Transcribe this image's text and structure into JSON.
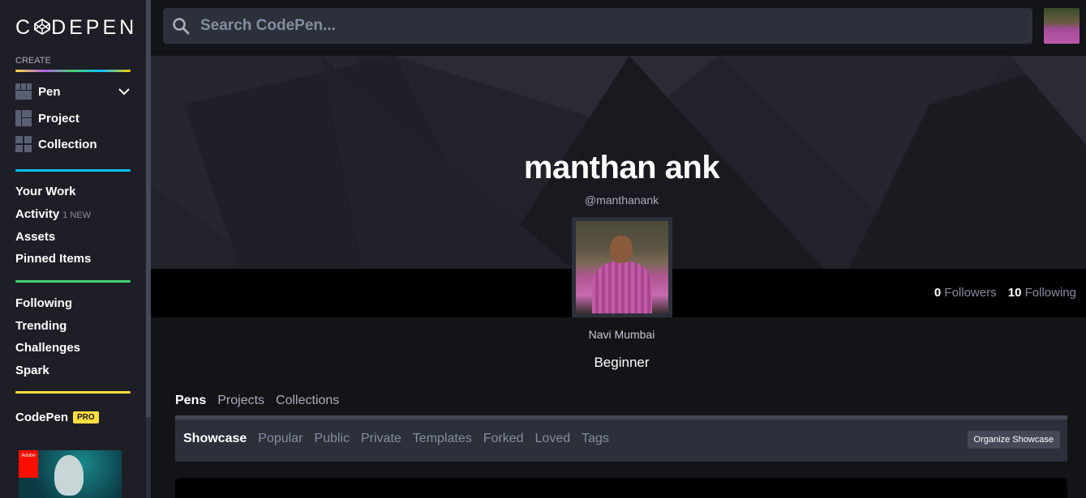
{
  "sidebar": {
    "logo_text": "CODEPEN",
    "create_label": "CREATE",
    "create_items": [
      {
        "label": "Pen",
        "icon": "pen-grid-icon"
      },
      {
        "label": "Project",
        "icon": "project-layout-icon"
      },
      {
        "label": "Collection",
        "icon": "collection-grid-icon"
      }
    ],
    "nav_group_1": [
      {
        "label": "Your Work"
      },
      {
        "label": "Activity",
        "badge": "1 NEW"
      },
      {
        "label": "Assets"
      },
      {
        "label": "Pinned Items"
      }
    ],
    "nav_group_2": [
      {
        "label": "Following"
      },
      {
        "label": "Trending"
      },
      {
        "label": "Challenges"
      },
      {
        "label": "Spark"
      }
    ],
    "codepen_label": "CodePen",
    "pro_badge": "PRO",
    "ad_brand": "Adobe"
  },
  "search": {
    "placeholder": "Search CodePen...",
    "value": ""
  },
  "profile": {
    "name": "manthan ank",
    "handle": "@manthanank",
    "location": "Navi Mumbai",
    "bio": "Beginner",
    "followers_count": "0",
    "followers_label": "Followers",
    "following_count": "10",
    "following_label": "Following"
  },
  "tabs": [
    {
      "label": "Pens",
      "active": true
    },
    {
      "label": "Projects",
      "active": false
    },
    {
      "label": "Collections",
      "active": false
    }
  ],
  "subtabs": [
    {
      "label": "Showcase",
      "active": true
    },
    {
      "label": "Popular",
      "active": false
    },
    {
      "label": "Public",
      "active": false
    },
    {
      "label": "Private",
      "active": false
    },
    {
      "label": "Templates",
      "active": false
    },
    {
      "label": "Forked",
      "active": false
    },
    {
      "label": "Loved",
      "active": false
    },
    {
      "label": "Tags",
      "active": false
    }
  ],
  "organize_button": "Organize Showcase",
  "colors": {
    "sidebar_bg": "#1e1f26",
    "page_bg": "#131417",
    "divider_blue": "#0ebeff",
    "divider_green": "#47cf73",
    "divider_yellow": "#ffdd40",
    "pro_yellow": "#ffdd40"
  }
}
